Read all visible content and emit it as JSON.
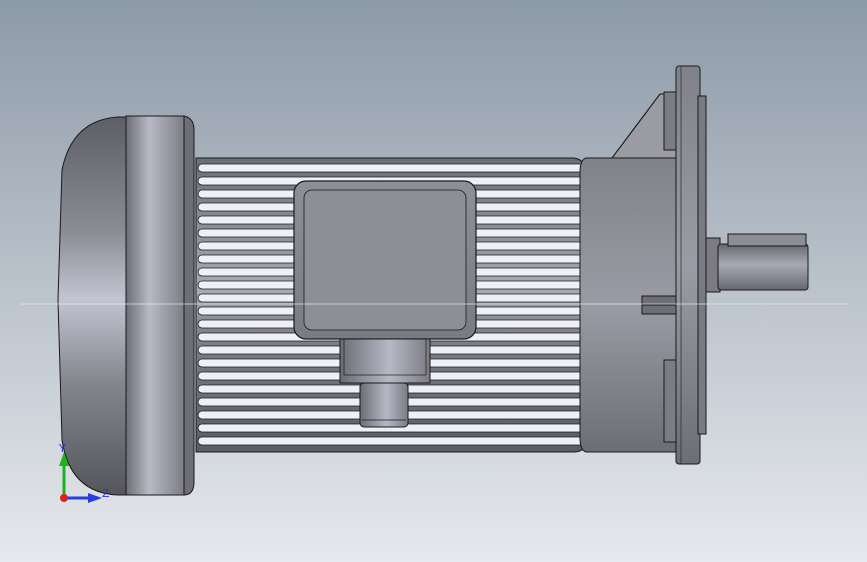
{
  "viewport": {
    "background_top": "#8d9aa8",
    "background_bottom": "#e6e9ed",
    "model_color": "#8e8f96",
    "model_edge_color": "#1a1a1a"
  },
  "triad": {
    "y_label": "Y",
    "z_label": "Z",
    "y_color": "#1fb21f",
    "z_color": "#2a3ee0",
    "x_color": "#e02020"
  },
  "reference_line": {
    "color": "#e8ecf2"
  }
}
